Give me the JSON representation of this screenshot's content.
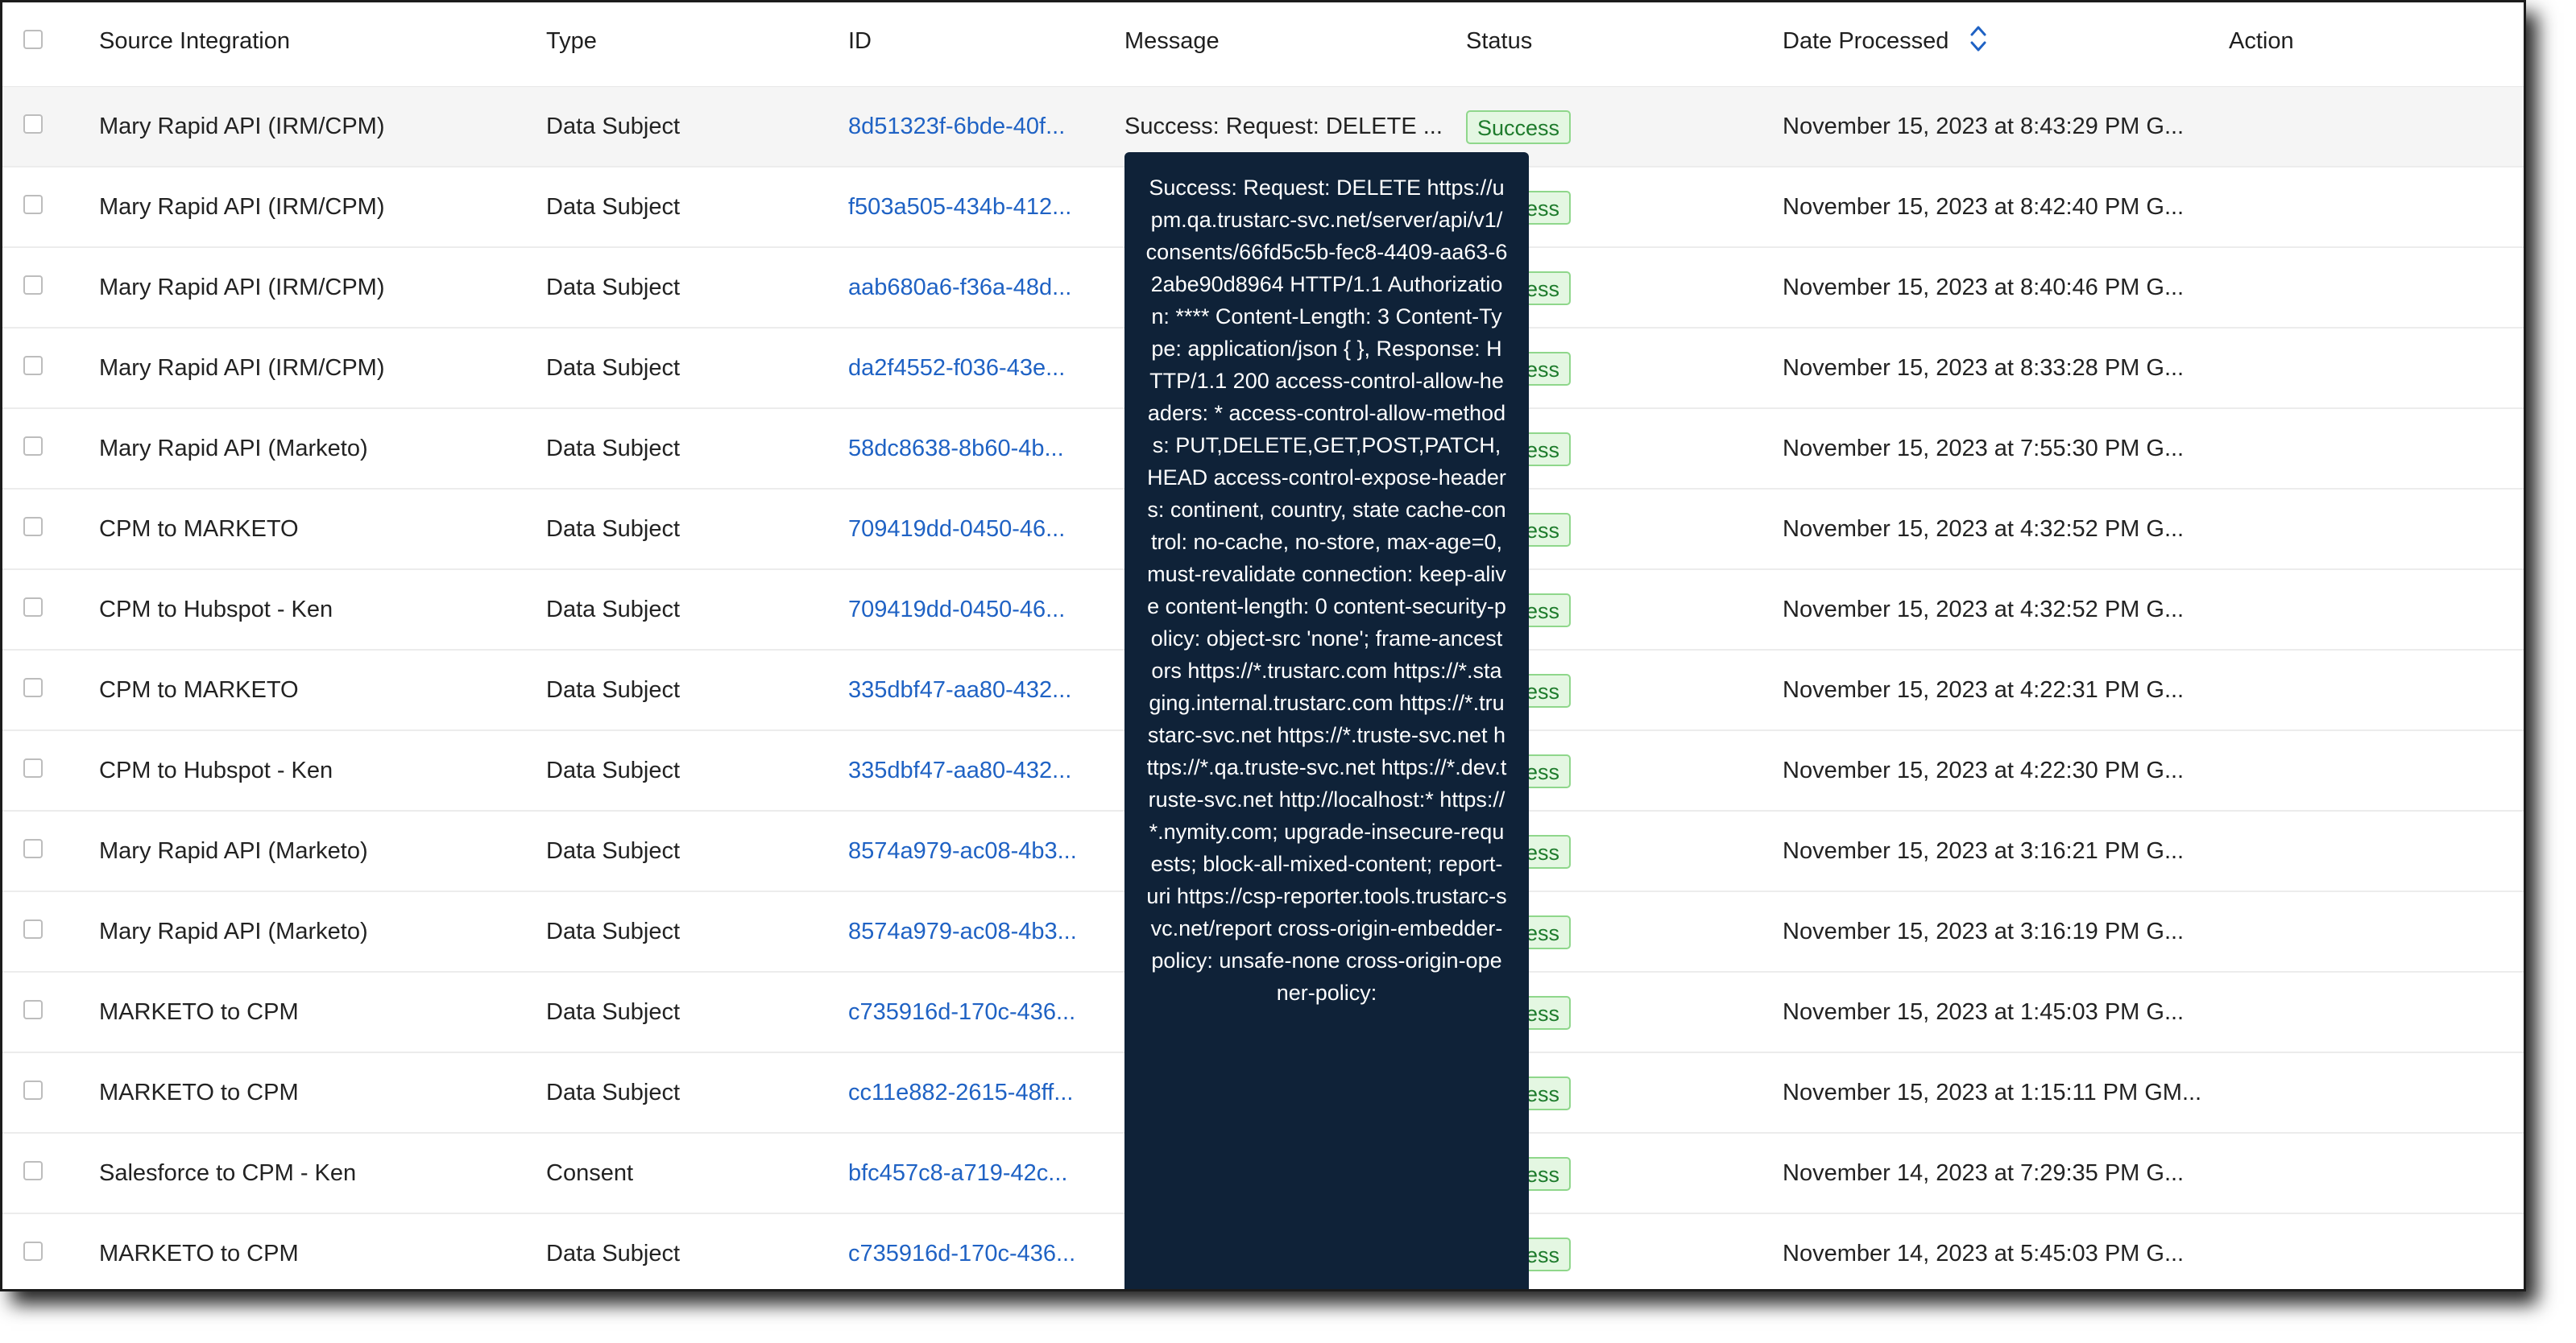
{
  "table": {
    "columns": {
      "source": "Source Integration",
      "type": "Type",
      "id": "ID",
      "message": "Message",
      "status": "Status",
      "date": "Date Processed",
      "action": "Action"
    },
    "rows": [
      {
        "source": "Mary Rapid API (IRM/CPM)",
        "type": "Data Subject",
        "id": "8d51323f-6bde-40f...",
        "message": "Success: Request: DELETE ...",
        "status": "Success",
        "date": "November 15, 2023 at 8:43:29 PM G..."
      },
      {
        "source": "Mary Rapid API (IRM/CPM)",
        "type": "Data Subject",
        "id": "f503a505-434b-412...",
        "message": "",
        "status": "Success",
        "date": "November 15, 2023 at 8:42:40 PM G..."
      },
      {
        "source": "Mary Rapid API (IRM/CPM)",
        "type": "Data Subject",
        "id": "aab680a6-f36a-48d...",
        "message": "",
        "status": "Success",
        "date": "November 15, 2023 at 8:40:46 PM G..."
      },
      {
        "source": "Mary Rapid API (IRM/CPM)",
        "type": "Data Subject",
        "id": "da2f4552-f036-43e...",
        "message": "",
        "status": "Success",
        "date": "November 15, 2023 at 8:33:28 PM G..."
      },
      {
        "source": "Mary Rapid API (Marketo)",
        "type": "Data Subject",
        "id": "58dc8638-8b60-4b...",
        "message": "",
        "status": "Success",
        "date": "November 15, 2023 at 7:55:30 PM G..."
      },
      {
        "source": "CPM to MARKETO",
        "type": "Data Subject",
        "id": "709419dd-0450-46...",
        "message": "",
        "status": "Success",
        "date": "November 15, 2023 at 4:32:52 PM G..."
      },
      {
        "source": "CPM to Hubspot - Ken",
        "type": "Data Subject",
        "id": "709419dd-0450-46...",
        "message": "",
        "status": "Success",
        "date": "November 15, 2023 at 4:32:52 PM G..."
      },
      {
        "source": "CPM to MARKETO",
        "type": "Data Subject",
        "id": "335dbf47-aa80-432...",
        "message": "",
        "status": "Success",
        "date": "November 15, 2023 at 4:22:31 PM G..."
      },
      {
        "source": "CPM to Hubspot - Ken",
        "type": "Data Subject",
        "id": "335dbf47-aa80-432...",
        "message": "",
        "status": "Success",
        "date": "November 15, 2023 at 4:22:30 PM G..."
      },
      {
        "source": "Mary Rapid API (Marketo)",
        "type": "Data Subject",
        "id": "8574a979-ac08-4b3...",
        "message": "",
        "status": "Success",
        "date": "November 15, 2023 at 3:16:21 PM G..."
      },
      {
        "source": "Mary Rapid API (Marketo)",
        "type": "Data Subject",
        "id": "8574a979-ac08-4b3...",
        "message": "",
        "status": "Success",
        "date": "November 15, 2023 at 3:16:19 PM G..."
      },
      {
        "source": "MARKETO to CPM",
        "type": "Data Subject",
        "id": "c735916d-170c-436...",
        "message": "",
        "status": "Success",
        "date": "November 15, 2023 at 1:45:03 PM G..."
      },
      {
        "source": "MARKETO to CPM",
        "type": "Data Subject",
        "id": "cc11e882-2615-48ff...",
        "message": "",
        "status": "Success",
        "date": "November 15, 2023 at 1:15:11 PM GM..."
      },
      {
        "source": "Salesforce to CPM - Ken",
        "type": "Consent",
        "id": "bfc457c8-a719-42c...",
        "message": "",
        "status": "Success",
        "date": "November 14, 2023 at 7:29:35 PM G..."
      },
      {
        "source": "MARKETO to CPM",
        "type": "Data Subject",
        "id": "c735916d-170c-436...",
        "message": "",
        "status": "Success",
        "date": "November 14, 2023 at 5:45:03 PM G..."
      }
    ]
  },
  "tooltip": {
    "text": "Success: Request: DELETE https://upm.qa.trustarc-svc.net/server/api/v1/consents/66fd5c5b-fec8-4409-aa63-62abe90d8964 HTTP/1.1 Authorization: **** Content-Length: 3 Content-Type: application/json { }, Response: HTTP/1.1 200 access-control-allow-headers: * access-control-allow-methods: PUT,DELETE,GET,POST,PATCH,HEAD access-control-expose-headers: continent, country, state cache-control: no-cache, no-store, max-age=0, must-revalidate connection: keep-alive content-length: 0 content-security-policy: object-src 'none'; frame-ancestors https://*.trustarc.com https://*.staging.internal.trustarc.com https://*.trustarc-svc.net https://*.truste-svc.net https://*.qa.truste-svc.net https://*.dev.truste-svc.net http://localhost:* https://*.nymity.com; upgrade-insecure-requests; block-all-mixed-content; report-uri https://csp-reporter.tools.trustarc-svc.net/report cross-origin-embedder-policy: unsafe-none cross-origin-opener-policy:"
  },
  "colors": {
    "link": "#1f62c4",
    "success_text": "#1e7b2c",
    "success_bg": "#e4f7e2",
    "tooltip_bg": "#0f2238"
  },
  "icons": {
    "sort": "sort-up-down-icon",
    "checkbox": "checkbox-icon"
  }
}
